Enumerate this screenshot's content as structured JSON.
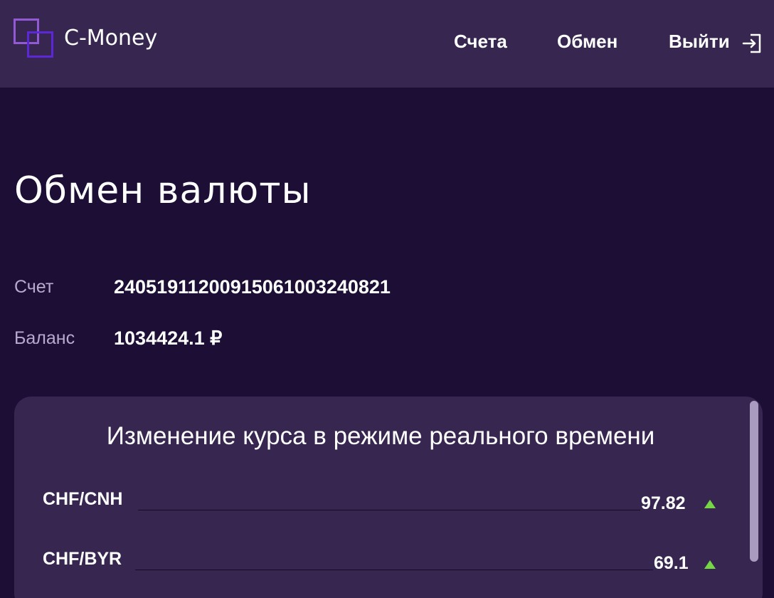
{
  "header": {
    "brand": "C-Money",
    "nav": {
      "accounts": "Счета",
      "exchange": "Обмен",
      "logout": "Выйти"
    }
  },
  "page": {
    "title": "Обмен валюты",
    "account_label": "Счет",
    "account_number": "24051911200915061003240821",
    "balance_label": "Баланс",
    "balance_value": "1034424.1 ₽"
  },
  "rates": {
    "title": "Изменение курса в режиме реального времени",
    "items": [
      {
        "pair": "CHF/CNH",
        "value": "97.82",
        "trend": "up"
      },
      {
        "pair": "CHF/BYR",
        "value": "69.1",
        "trend": "up"
      }
    ]
  },
  "colors": {
    "background": "#1d0e35",
    "header": "#372750",
    "card": "#372750",
    "trend_up": "#76d645",
    "muted_label": "#b8aace"
  },
  "icons": {
    "logo": "two-overlapping-squares",
    "logout": "logout-icon",
    "trend_up": "triangle-up-icon"
  }
}
